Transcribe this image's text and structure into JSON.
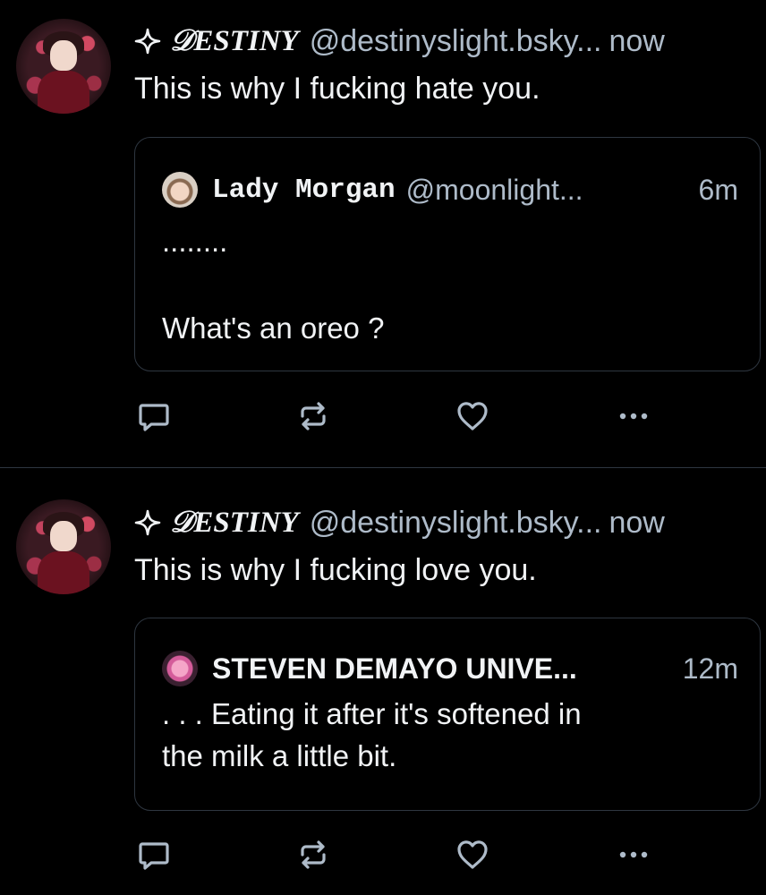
{
  "posts": [
    {
      "author_name": "𝒟ESTINY",
      "handle": "@destinyslight.bsky...",
      "time": "now",
      "text": "This is why I fucking hate you.",
      "quote": {
        "author_name": "Lady Morgan",
        "handle": "@moonlight...",
        "time": "6m",
        "text": "........\n\nWhat's an oreo ?"
      }
    },
    {
      "author_name": "𝒟ESTINY",
      "handle": "@destinyslight.bsky...",
      "time": "now",
      "text": "This is why I fucking love you.",
      "quote": {
        "author_name": "STEVEN DEMAYO UNIVE...",
        "handle": "",
        "time": "12m",
        "text": ". . . Eating it after it's softened in\nthe milk a little bit."
      }
    }
  ],
  "icons": {
    "reply": "reply-icon",
    "repost": "repost-icon",
    "like": "heart-icon",
    "more": "more-icon",
    "sparkle": "sparkle-icon"
  },
  "colors": {
    "background": "#000000",
    "text": "#f1f3f5",
    "muted": "#aebbc9",
    "border": "#2e3640"
  }
}
